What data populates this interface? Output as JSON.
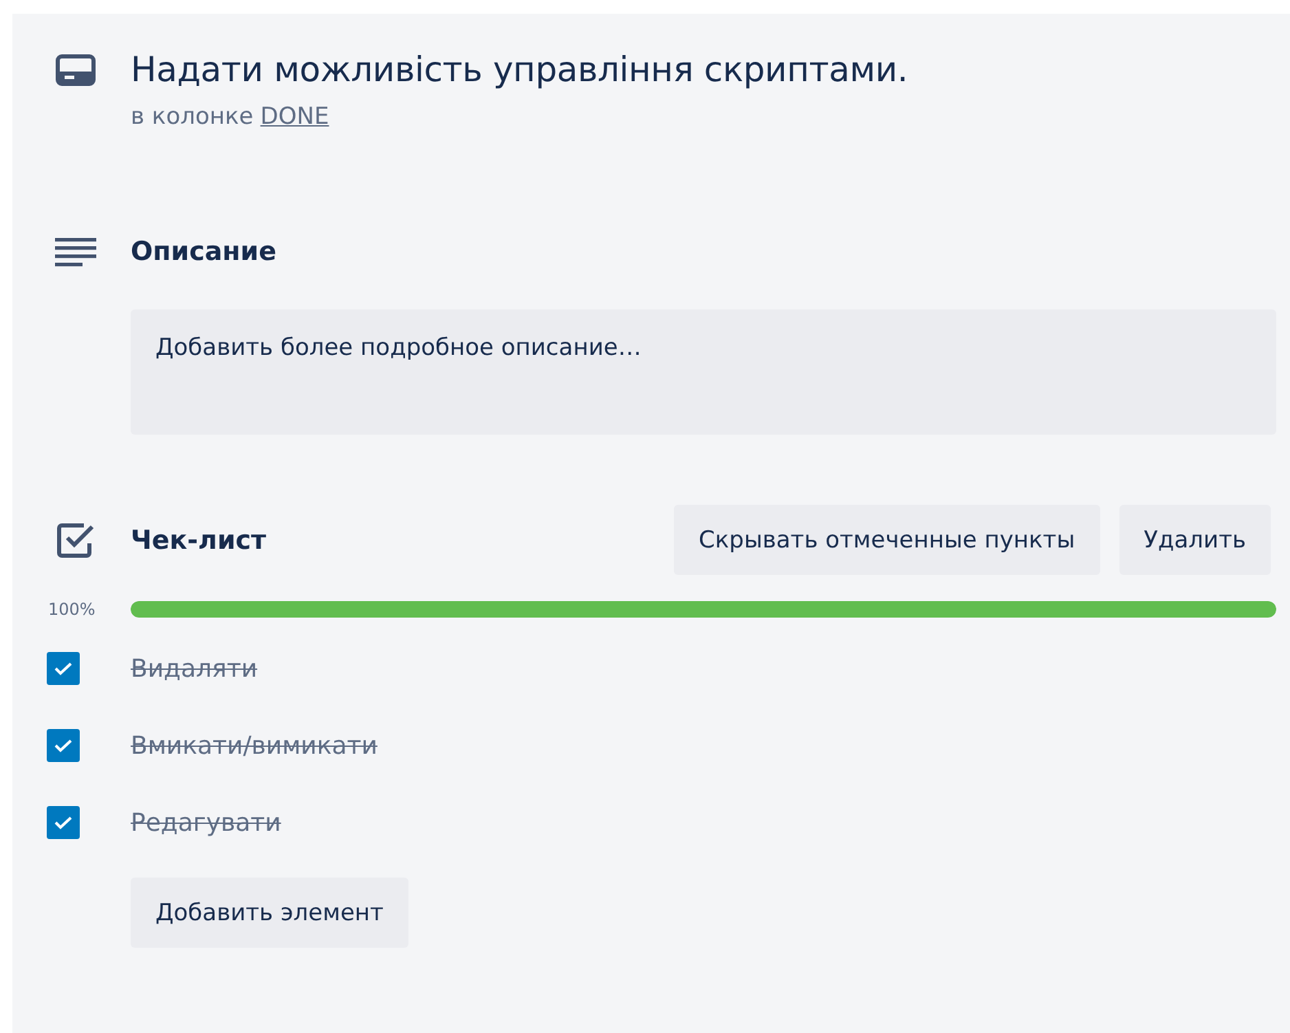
{
  "card": {
    "title": "Надати можливість управління скриптами.",
    "column_prefix": "в колонке",
    "column_link": "DONE"
  },
  "description": {
    "heading": "Описание",
    "placeholder": "Добавить более подробное описание…"
  },
  "checklist": {
    "heading": "Чек-лист",
    "buttons": [
      "Скрывать отмеченные пункты",
      "Удалить"
    ],
    "percent": "100%",
    "level": 1,
    "items": [
      {
        "label": "Видаляти",
        "checked": true
      },
      {
        "label": "Вмикати/вимикати",
        "checked": true
      },
      {
        "label": "Редагувати",
        "checked": true
      }
    ],
    "add_button": "Добавить элемент"
  }
}
